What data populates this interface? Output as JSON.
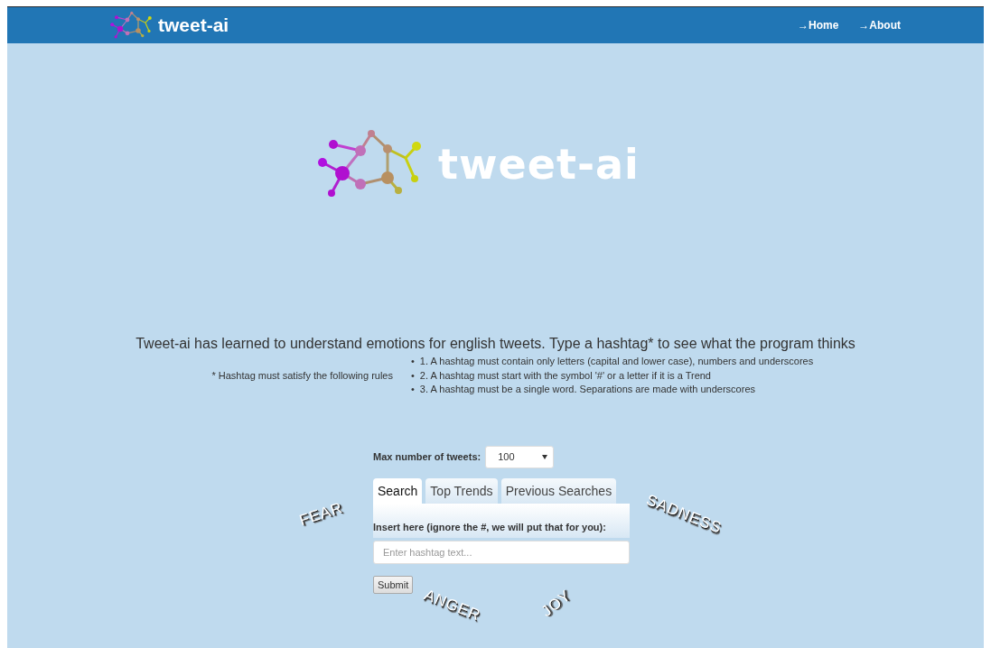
{
  "navbar": {
    "brand": "tweet-ai",
    "links": [
      {
        "arrow": "→",
        "label": "Home"
      },
      {
        "arrow": "→",
        "label": "About"
      }
    ]
  },
  "hero": {
    "logo_text": "tweet-ai"
  },
  "intro": "Tweet-ai has learned to understand emotions for english tweets. Type a hashtag* to see what the program thinks",
  "rules": {
    "note": "* Hashtag must satisfy the following rules",
    "items": [
      {
        "bullet": "•",
        "text": "1. A hashtag must contain only letters (capital and lower case), numbers and underscores"
      },
      {
        "bullet": "•",
        "text": "2. A hashtag must start with the symbol '#' or a letter if it is a Trend"
      },
      {
        "bullet": "•",
        "text": "3. A hashtag must be a single word. Separations are made with underscores"
      }
    ]
  },
  "form": {
    "max_label": "Max number of tweets:",
    "max_value": "100",
    "tabs": [
      {
        "label": "Search",
        "selected": true
      },
      {
        "label": "Top Trends",
        "selected": false
      },
      {
        "label": "Previous Searches",
        "selected": false
      }
    ],
    "input_label": "Insert here (ignore the #, we will put that for you):",
    "placeholder": "Enter hashtag text...",
    "submit": "Submit"
  },
  "emotions": [
    {
      "label": "FEAR",
      "kind": "fear"
    },
    {
      "label": "SADNESS",
      "kind": "sadness"
    },
    {
      "label": "ANGER",
      "kind": "anger"
    },
    {
      "label": "JOY",
      "kind": "joy"
    }
  ]
}
